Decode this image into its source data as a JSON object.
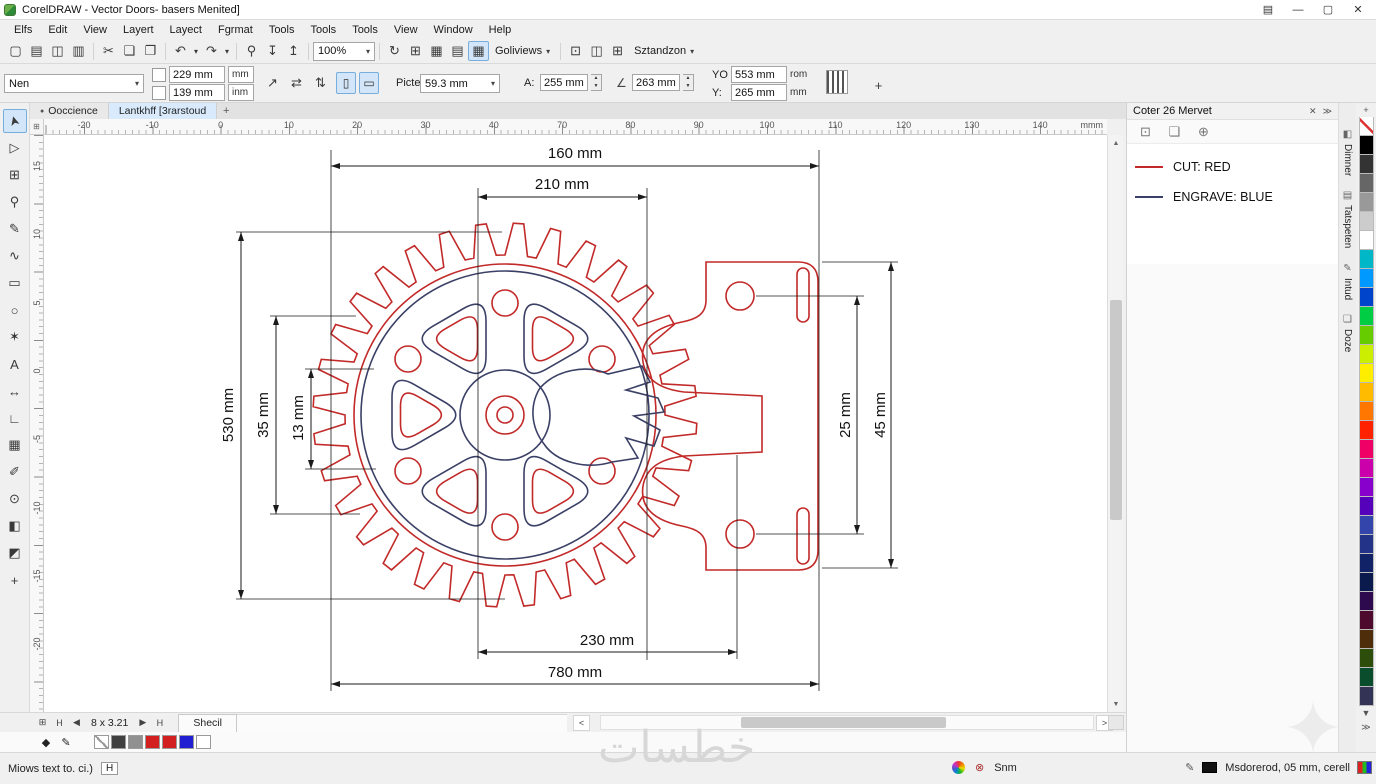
{
  "window": {
    "title": "CorelDRAW - Vector Doors- basers Menited]",
    "controls": {
      "minimize": "—",
      "maximize": "▢",
      "close": "✕",
      "docs": "▤"
    }
  },
  "menu": {
    "items": [
      "Elfs",
      "Edit",
      "View",
      "Layert",
      "Layect",
      "Fgrmat",
      "Tools",
      "Tools",
      "Tools",
      "View",
      "Window",
      "Help"
    ]
  },
  "toolbar": {
    "file_icons": [
      {
        "name": "new-document-icon",
        "glyph": "▢"
      },
      {
        "name": "open-icon",
        "glyph": "▤"
      },
      {
        "name": "save-icon",
        "glyph": "◫"
      },
      {
        "name": "print-icon",
        "glyph": "▥"
      }
    ],
    "edit_icons": [
      {
        "name": "cut-icon",
        "glyph": "✂"
      },
      {
        "name": "copy-icon",
        "glyph": "❏"
      },
      {
        "name": "paste-icon",
        "glyph": "❐"
      }
    ],
    "undo_icons": [
      {
        "name": "undo-icon",
        "glyph": "↶"
      },
      {
        "name": "undo-dropdown-icon",
        "glyph": "▾",
        "small": true
      },
      {
        "name": "redo-icon",
        "glyph": "↷"
      },
      {
        "name": "redo-dropdown-icon",
        "glyph": "▾",
        "small": true
      }
    ],
    "io_icons": [
      {
        "name": "search-icon",
        "glyph": "⚲"
      },
      {
        "name": "import-icon",
        "glyph": "↧"
      },
      {
        "name": "export-icon",
        "glyph": "↥"
      }
    ],
    "zoom_level": "100%",
    "view_icons": [
      {
        "name": "refresh-icon",
        "glyph": "↻"
      },
      {
        "name": "snap-icon",
        "glyph": "⊞"
      },
      {
        "name": "grid-icon",
        "glyph": "▦"
      },
      {
        "name": "rulers-toggle-icon",
        "glyph": "▤"
      },
      {
        "name": "guidelines-toggle-icon",
        "glyph": "▦",
        "active": true
      }
    ],
    "views_label": "Goliviews",
    "options_icons": [
      {
        "name": "page-border-icon",
        "glyph": "⊡"
      },
      {
        "name": "layout-icon",
        "glyph": "◫"
      },
      {
        "name": "options-grid-icon",
        "glyph": "⊞"
      }
    ],
    "standard_label": "Sztandzon",
    "dropdown_caret": "▾"
  },
  "propbar": {
    "preset_value": "Nen",
    "pos_x": "229 mm",
    "pos_x_unit": "mm",
    "pos_y": "139 mm",
    "pos_y_unit": "inm",
    "transform_icons": [
      {
        "name": "nudge-icon",
        "glyph": "↗"
      },
      {
        "name": "mirror-horizontal-icon",
        "glyph": "⇄"
      },
      {
        "name": "mirror-vertical-icon",
        "glyph": "⇅"
      },
      {
        "name": "lock-ratio-icon",
        "glyph": "⊙"
      }
    ],
    "orientation_toggles": [
      {
        "name": "portrait-toggle",
        "glyph": "▯",
        "active": true
      },
      {
        "name": "landscape-toggle",
        "glyph": "▭",
        "active": true
      }
    ],
    "size_label": "Picte",
    "size_value": "59.3 mm",
    "width_label": "A:",
    "width_value": "255 mm",
    "angle_glyph": "∠",
    "angle_value": "263 mm",
    "y0_label": "YO",
    "y0_value": "553 mm",
    "y0_unit": "rom",
    "y1_label": "Y:",
    "y1_value": "265 mm",
    "y1_unit": "mm",
    "plus_glyph": "+"
  },
  "doc_tabs": {
    "tabs": [
      {
        "label": "Ooccience",
        "icon": "●",
        "active": false
      },
      {
        "label": "Lantkhff [3rarstoud",
        "icon": "",
        "active": true
      }
    ],
    "add_glyph": "+"
  },
  "ruler": {
    "h_labels": [
      "-20",
      "-10",
      "0",
      "10",
      "20",
      "30",
      "40",
      "70",
      "80",
      "90",
      "100",
      "110",
      "120",
      "130",
      "140"
    ],
    "v_labels": [
      "15",
      "10",
      "5",
      "0",
      "-5",
      "-10",
      "-15",
      "-20"
    ],
    "unit": "mmm",
    "origin_glyph": "⊞"
  },
  "toolbox": {
    "tools": [
      {
        "name": "pick-tool",
        "glyph": "➤",
        "active": true
      },
      {
        "name": "shape-tool",
        "glyph": "▷"
      },
      {
        "name": "crop-tool",
        "glyph": "⊞"
      },
      {
        "name": "zoom-tool",
        "glyph": "⚲"
      },
      {
        "name": "freehand-tool",
        "glyph": "✎"
      },
      {
        "name": "bezier-tool",
        "glyph": "∿"
      },
      {
        "name": "rectangle-tool",
        "glyph": "▭"
      },
      {
        "name": "ellipse-tool",
        "glyph": "○"
      },
      {
        "name": "polygon-tool",
        "glyph": "✶"
      },
      {
        "name": "text-tool",
        "glyph": "A"
      },
      {
        "name": "dimension-tool",
        "glyph": "↔"
      },
      {
        "name": "connector-tool",
        "glyph": "∟"
      },
      {
        "name": "table-tool",
        "glyph": "▦"
      },
      {
        "name": "eyedropper-tool",
        "glyph": "✐"
      },
      {
        "name": "outline-pen-tool",
        "glyph": "⊙"
      },
      {
        "name": "fill-tool",
        "glyph": "◧"
      },
      {
        "name": "interactive-fill-tool",
        "glyph": "◩"
      },
      {
        "name": "add-tool-button",
        "glyph": "+"
      }
    ]
  },
  "drawing": {
    "colors": {
      "cut": "#c22a29",
      "engrave": "#3b4066",
      "dimension": "#1a1a1a"
    },
    "dims": {
      "d160": "160 mm",
      "d210": "210 mm",
      "d530": "530 mm",
      "d35": "35 mm",
      "d13": "13 mm",
      "d25": "25 mm",
      "d45": "45 mm",
      "d230": "230 mm",
      "d780": "780 mm"
    }
  },
  "docker": {
    "title": "Coter 26 Mervet",
    "close_glyph": "✕",
    "collapse_glyph": "≫",
    "tool_icons": [
      {
        "name": "select-frame-icon",
        "glyph": "⊡"
      },
      {
        "name": "copy-style-icon",
        "glyph": "❏"
      },
      {
        "name": "globe-icon",
        "glyph": "⊕"
      }
    ],
    "legend": [
      {
        "label": "CUT: RED",
        "color": "#c22a29"
      },
      {
        "label": "ENGRAVE: BLUE",
        "color": "#3b4066"
      }
    ],
    "side_tabs": [
      {
        "label": "Dimner",
        "glyph": "◧"
      },
      {
        "label": "Tatspeten",
        "glyph": "▤"
      },
      {
        "label": "Intud",
        "glyph": "✎"
      },
      {
        "label": "Doze",
        "glyph": "❏"
      }
    ]
  },
  "palette": {
    "add_glyph": "+",
    "down_glyph": "▼",
    "more_glyph": "≫",
    "colors": [
      "none",
      "#000000",
      "#333333",
      "#666666",
      "#999999",
      "#cccccc",
      "#ffffff",
      "#00b7c8",
      "#0099ff",
      "#0044cc",
      "#00cc44",
      "#66cc00",
      "#ccee00",
      "#ffee00",
      "#ffbb00",
      "#ff7700",
      "#ff2200",
      "#ee0066",
      "#cc00aa",
      "#8800cc",
      "#5500bb",
      "#3344aa",
      "#223388",
      "#112266",
      "#0a1a4d",
      "#2d0a4d",
      "#4d0a2d",
      "#4d2d0a",
      "#2d4d0a",
      "#0a4d2d",
      "#333355"
    ]
  },
  "pagebar": {
    "nav_icons": [
      {
        "name": "pages-grid-icon",
        "glyph": "⊞"
      },
      {
        "name": "first-page-icon",
        "glyph": "H"
      },
      {
        "name": "prev-page-icon",
        "glyph": "◀"
      }
    ],
    "page_info": "8 x 3.21",
    "nav_icons_after": [
      {
        "name": "next-page-icon",
        "glyph": "▶"
      },
      {
        "name": "last-page-icon",
        "glyph": "H"
      }
    ],
    "page_tab": "Shecil",
    "left_glyph": "<",
    "right_glyph": ">"
  },
  "objbar": {
    "fill_glyph": "◆",
    "outline_glyph": "✎",
    "wells": [
      "none",
      "#404040",
      "#909090",
      "#d22020",
      "#d22020",
      "#2020d2",
      "#ffffff"
    ]
  },
  "statusbar": {
    "left": "Miows text to. ci.)",
    "hint_key": "H",
    "snap_label": "Snm",
    "snap_glyph": "⊗",
    "pen_glyph": "✎",
    "right": "Msdorerod, 05 mm, cerell"
  },
  "watermark": {
    "text": "خطسات",
    "flourish": "✦"
  }
}
